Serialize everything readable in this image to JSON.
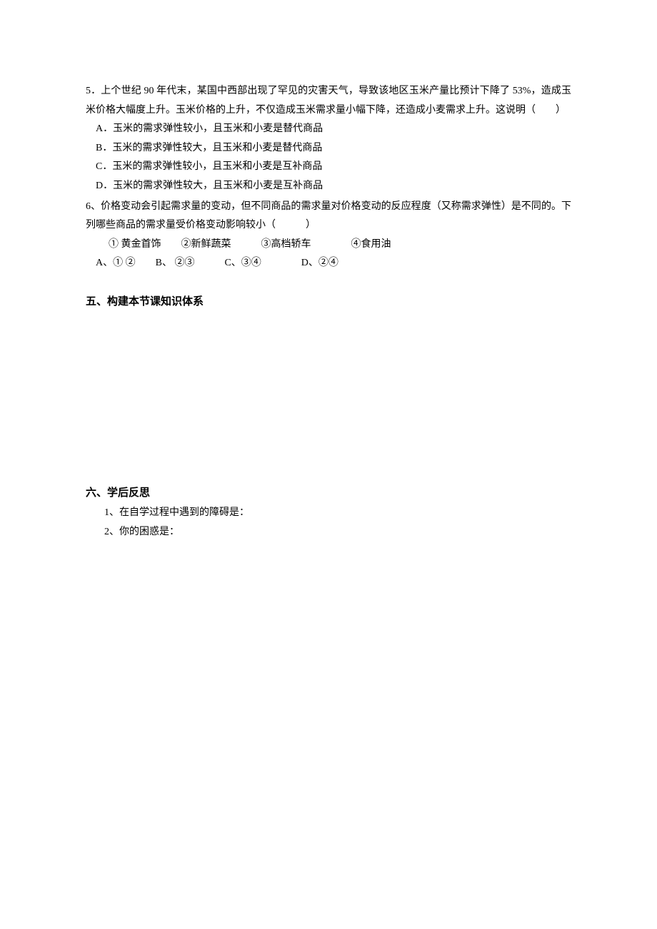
{
  "q5": {
    "stem": "5．上个世纪 90 年代末，某国中西部出现了罕见的灾害天气，导致该地区玉米产量比预计下降了 53%，造成玉米价格大幅度上升。玉米价格的上升，不仅造成玉米需求量小幅下降，还造成小麦需求上升。这说明（　　）",
    "a": "A．玉米的需求弹性较小，且玉米和小麦是替代商品",
    "b": "B．玉米的需求弹性较大，且玉米和小麦是替代商品",
    "c": "C．玉米的需求弹性较小，且玉米和小麦是互补商品",
    "d": "D．玉米的需求弹性较大，且玉米和小麦是互补商品"
  },
  "q6": {
    "stem": "6、价格变动会引起需求量的变动，但不同商品的需求量对价格变动的反应程度（又称需求弹性）是不同的。下列哪些商品的需求量受价格变动影响较小（　　　）",
    "choices": "① 黄金首饰　　②新鲜蔬菜　　　③高档轿车　　　　④食用油",
    "answers": "A、① ②　　B、 ②③　　　C、③④　　　　D、②④"
  },
  "section5": "五、构建本节课知识体系",
  "section6": {
    "heading": "六、学后反思",
    "line1": "1、在自学过程中遇到的障碍是：",
    "line2": "2、你的困惑是："
  }
}
